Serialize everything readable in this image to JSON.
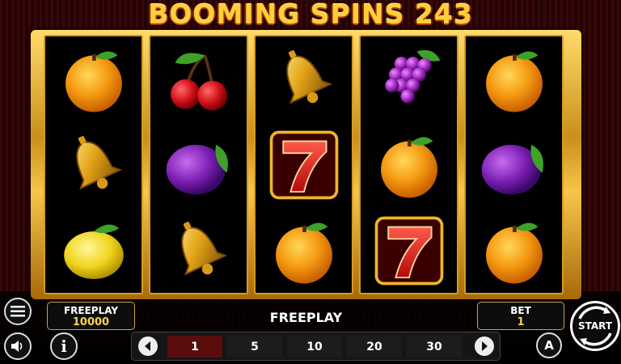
{
  "game": {
    "title": "BOOMING SPINS 243"
  },
  "reels": [
    [
      "orange",
      "bell",
      "lemon"
    ],
    [
      "cherry",
      "plum",
      "bell"
    ],
    [
      "bell",
      "seven",
      "orange"
    ],
    [
      "grapes",
      "orange",
      "seven"
    ],
    [
      "orange",
      "plum",
      "orange"
    ]
  ],
  "panel": {
    "freeplay_label": "FREEPLAY",
    "freeplay_value": "10000",
    "status_text": "FREEPLAY",
    "bet_label": "BET",
    "bet_value": "1",
    "start_label": "START",
    "auto_label": "A",
    "info_label": "i"
  },
  "bet_options": [
    "1",
    "5",
    "10",
    "20",
    "30"
  ],
  "selected_bet": "1",
  "icons": [
    "menu-icon",
    "sound-icon",
    "info-icon",
    "left-arrow-icon",
    "right-arrow-icon",
    "autoplay-icon",
    "start-icon"
  ],
  "colors": {
    "gold": "#f2c14a",
    "reel_bg": "#000000",
    "selected_bet": "#5a0d0d"
  }
}
